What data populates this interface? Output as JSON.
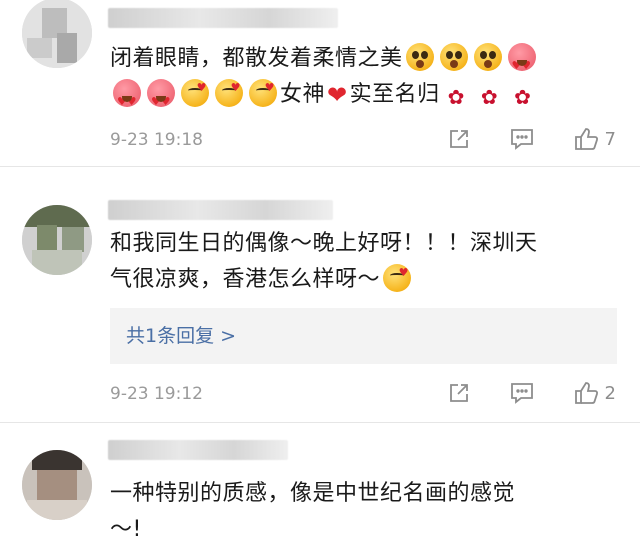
{
  "comments": [
    {
      "text_line1": "闭着眼睛，都散发着柔情之美",
      "text_line2_a": "女神",
      "text_line2_b": "实至名归",
      "time": "9-23 19:18",
      "likes": "7"
    },
    {
      "text_line1": "和我同生日的偶像～晚上好呀！！！深圳天",
      "text_line2": "气很凉爽，香港怎么样呀～",
      "reply_link": "共1条回复 >",
      "time": "9-23 19:12",
      "likes": "2"
    },
    {
      "text_line1": "一种特别的质感，像是中世纪名画的感觉",
      "text_line2": "～!"
    }
  ],
  "icons": {
    "emoji_1": "astonished-face-emoji",
    "emoji_2": "heart-eyes-emoji",
    "emoji_3": "kissing-heart-emoji",
    "rose": "rose-icon",
    "heart": "red-heart-icon",
    "share": "share-icon",
    "comment": "comment-icon",
    "like": "thumbs-up-icon"
  },
  "colors": {
    "link": "#4a6fa5",
    "meta": "#9a9a9a",
    "reply_bg": "#f3f3f3"
  }
}
